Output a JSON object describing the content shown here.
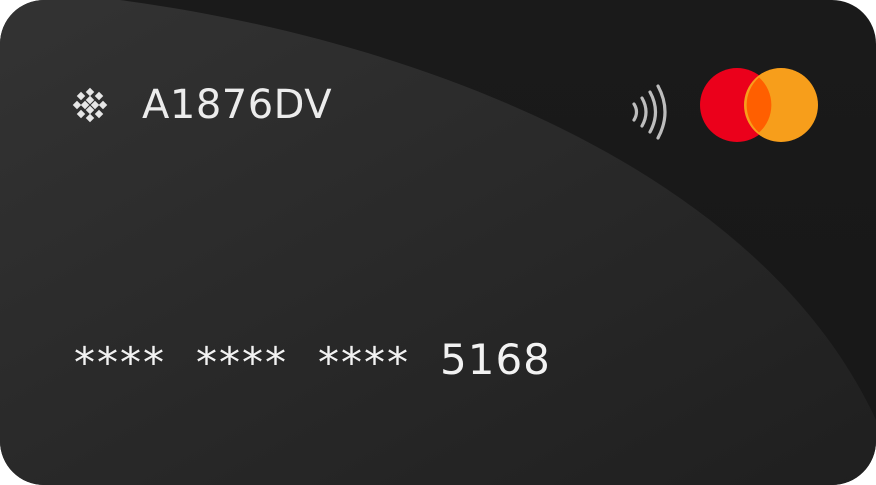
{
  "card": {
    "brand_name": "A1876DV",
    "brand_icon": "snowflake-icon",
    "contactless_icon": "contactless-icon",
    "network_logo": "mastercard-logo",
    "network_colors": {
      "left": "#eb001b",
      "right": "#f79e1b",
      "overlap": "#ff5f00"
    },
    "number_groups": [
      "****",
      "****",
      "****"
    ],
    "last_four": "5168",
    "background": "#1c1c1c"
  }
}
